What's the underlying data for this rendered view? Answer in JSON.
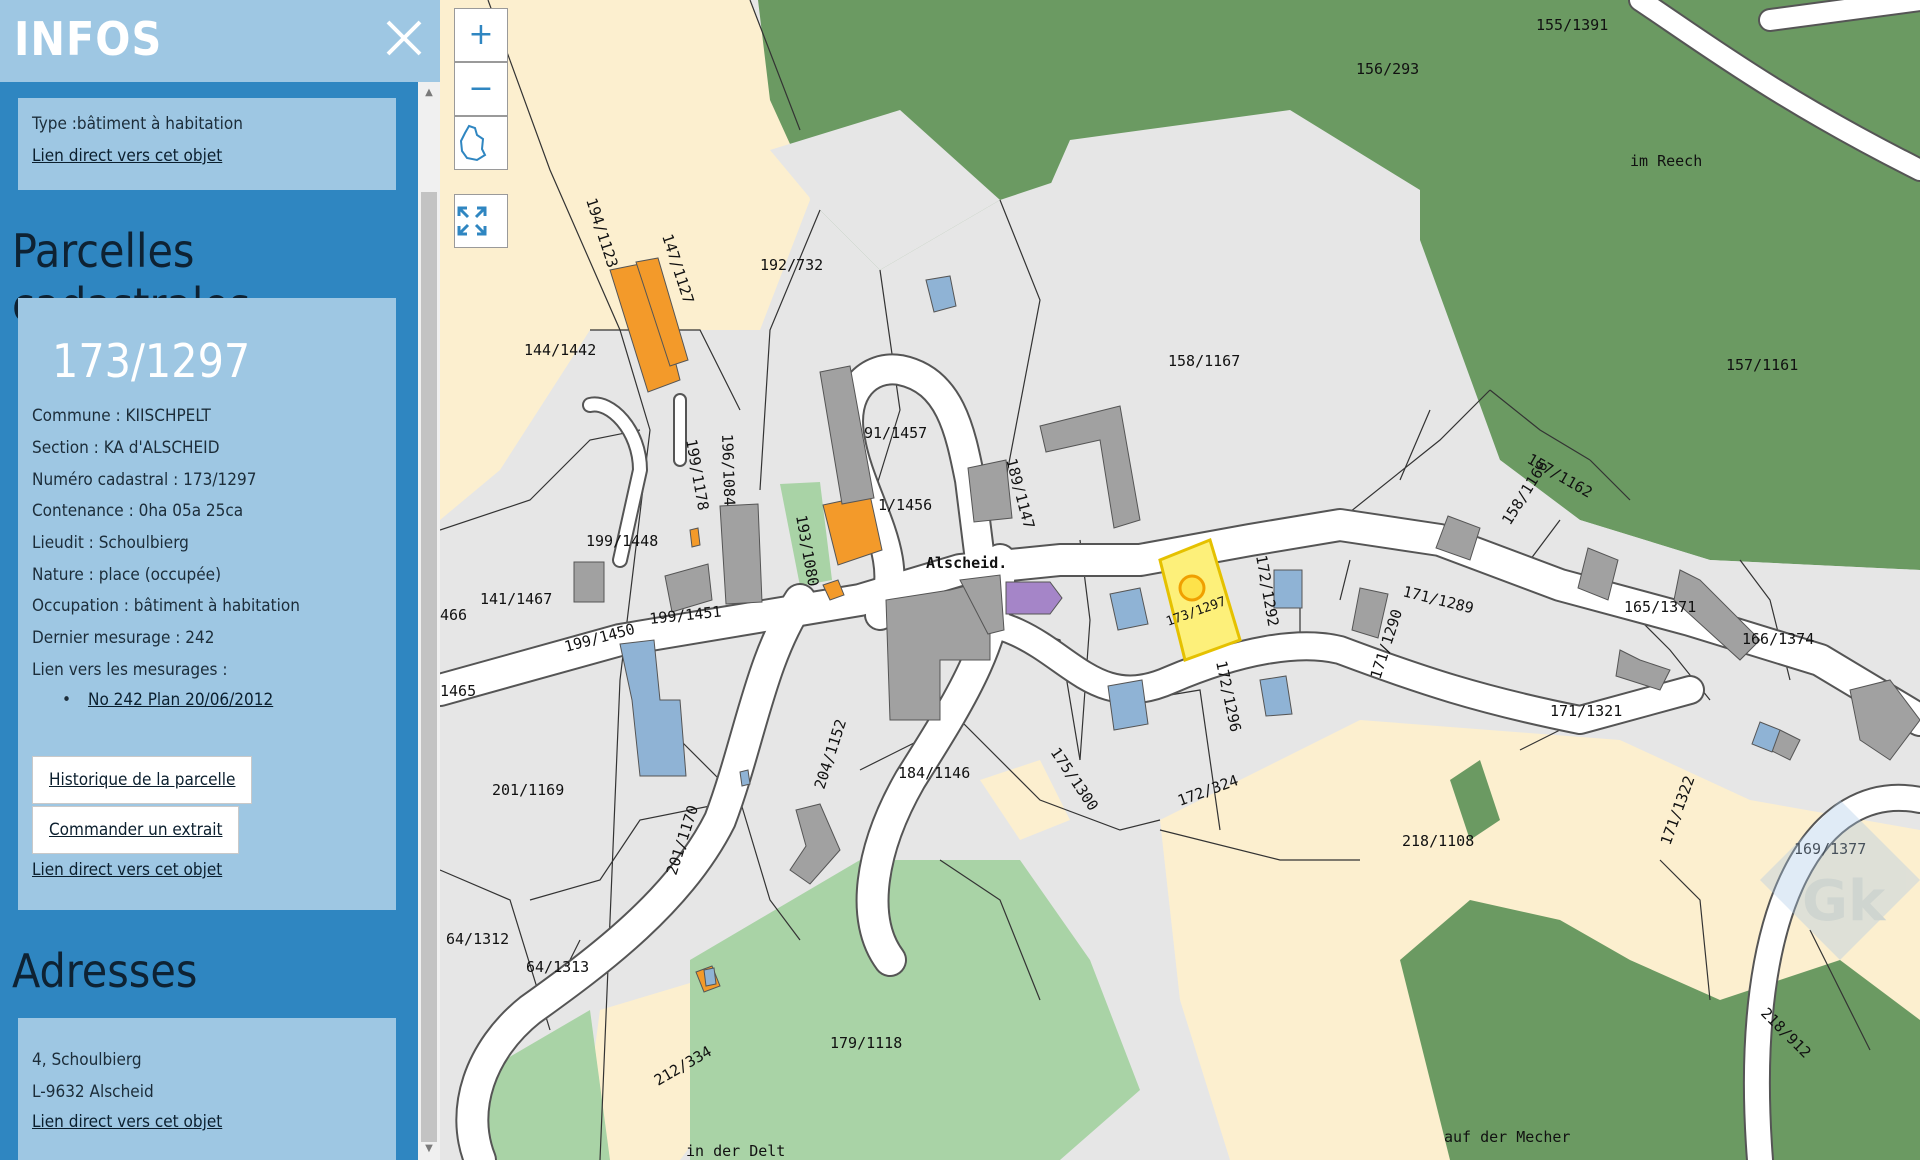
{
  "panel": {
    "title": "INFOS",
    "object_card": {
      "type_text": "Type :bâtiment à habitation",
      "link": "Lien direct vers cet objet"
    },
    "parcels_section": {
      "heading": "Parcelles cadastrales",
      "parcel_number": "173/1297",
      "lines": [
        "Commune : KIISCHPELT",
        "Section : KA d'ALSCHEID",
        "Numéro cadastral : 173/1297",
        "Contenance : 0ha 05a 25ca",
        "Lieudit : Schoulbierg",
        "Nature : place (occupée)",
        "Occupation : bâtiment à habitation",
        "Dernier mesurage : 242",
        "Lien vers les mesurages :"
      ],
      "measurement_link": "No 242 Plan 20/06/2012",
      "history_button": "Historique de la parcelle",
      "order_button": "Commander un extrait",
      "link": "Lien direct vers cet objet"
    },
    "addresses_section": {
      "heading": "Adresses",
      "line1": "4, Schoulbierg",
      "line2": "L-9632 Alscheid",
      "link": "Lien direct vers cet objet"
    }
  },
  "map": {
    "controls": {
      "zoom_in": "+",
      "zoom_out": "−",
      "country_icon": "luxembourg-outline-icon",
      "fullscreen_icon": "fullscreen-icon"
    },
    "colors": {
      "forest": "#6b9a62",
      "parcel": "#e6e6e6",
      "field": "#fcefcf",
      "meadow": "#a9d3a6",
      "road": "#ffffff",
      "building_grey": "#a1a1a1",
      "building_orange": "#f39a2a",
      "building_blue": "#8fb3d5",
      "building_purple": "#a585c8",
      "highlight": "#fdf07a"
    },
    "labels": [
      "155/1391",
      "156/293",
      "im Reech",
      "157/1161",
      "192/732",
      "144/1442",
      "194/1123",
      "147/1127",
      "158/1167",
      "91/1457",
      "189/1147",
      "199/1448",
      "199/1178",
      "196/1084",
      "141/1467",
      "199/1450",
      "199/1451",
      "1/1456",
      "193/1080",
      "Alscheid.",
      "172/1292",
      "158/1166",
      "157/1162",
      "165/1371",
      "166/1374",
      "171/1289",
      "171/1290",
      "171/1321",
      "201/1169",
      "201/1170",
      "204/1152",
      "184/1146",
      "175/1300",
      "172/1296",
      "172/324",
      "218/1108",
      "169/1377",
      "171/1322",
      "64/1312",
      "64/1313",
      "179/1118",
      "212/334",
      "in der Delt",
      "auf der Mecher",
      "218/912",
      "1465",
      "466",
      "173/1297"
    ]
  }
}
